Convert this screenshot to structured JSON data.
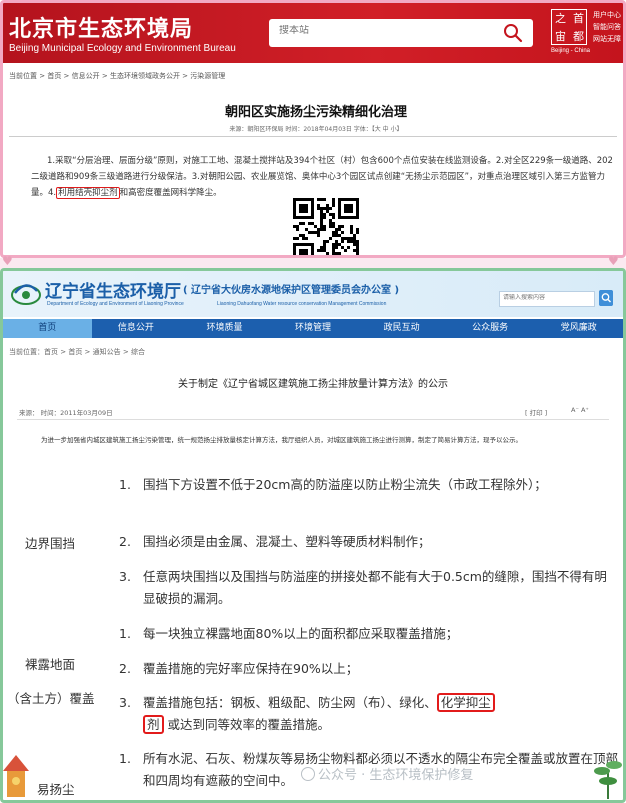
{
  "beijing": {
    "header": {
      "title": "北京市生态环境局",
      "subtitle": "Beijing Municipal Ecology and Environment Bureau",
      "search_placeholder": "搜本站",
      "logo_chars": [
        "之",
        "首",
        "宙",
        "都"
      ],
      "logo_caption": "Beijing - China",
      "links": [
        "用户中心",
        "智能问答",
        "网站无障"
      ]
    },
    "breadcrumb": "当前位置 > 首页 > 信息公开 > 生态环境领域政务公开 > 污染源管理",
    "article": {
      "title": "朝阳区实施扬尘污染精细化治理",
      "meta": "来源：朝阳区环保局    时间：2018年04月03日    字体：【大 中 小】",
      "body_part1": "1.采取“分层治理、层面分级”原则，对施工工地、混凝土搅拌站及394个社区（村）包含600个点位安装在线监测设备。2.对全区229条一级道路、202二级道路和909条三级道路进行分级保洁。3.对朝阳公园、农业展览馆、奥体中心3个园区试点创建“无扬尘示范园区”，对重点治理区域引入第三方监管力量。4.",
      "body_highlight": "利用结壳抑尘剂",
      "body_part2": "和高密度覆盖网科学降尘。"
    }
  },
  "liaoning": {
    "header": {
      "title": "辽宁省生态环境厅",
      "title_sub": "( 辽宁省大伙房水源地保护区管理委员会办公室 )",
      "en_left": "Department of Ecology and Environment of Liaoning Province",
      "en_right": "Liaoning Dahuofang Water resource conservation Management Commission",
      "search_placeholder": "请输入搜索内容"
    },
    "nav": [
      "首页",
      "信息公开",
      "环境质量",
      "环境管理",
      "政民互动",
      "公众服务",
      "党风廉政"
    ],
    "breadcrumb": "当前位置：首页 > 首页 > 通知公告 > 综合",
    "article": {
      "title": "关于制定《辽宁省城区建筑施工扬尘排放量计算方法》的公示",
      "source": "来源：    时间：2011年03月09日",
      "print": "[ 打印 ]",
      "font_controls": "A⁻  A⁺",
      "intro": "为进一步加强省内城区建筑施工扬尘污染管理，统一规范扬尘排放量核定计算方法，我厅组织人员，对城区建筑施工扬尘进行测算，制定了简易计算方法，现予以公示。"
    },
    "categories": [
      "边界围挡",
      "裸露地面",
      "（含土方）覆盖",
      "易扬尘"
    ],
    "items": [
      {
        "num": "1.",
        "text": "围挡下方设置不低于20cm高的防溢座以防止粉尘流失（市政工程除外）；"
      },
      {
        "num": "2.",
        "text": "围挡必须是由金属、混凝土、塑料等硬质材料制作；"
      },
      {
        "num": "3.",
        "text": "任意两块围挡以及围挡与防溢座的拼接处都不能有大于0.5cm的缝隙，围挡不得有明显破损的漏洞。"
      },
      {
        "num": "1.",
        "text": "每一块独立裸露地面80%以上的面积都应采取覆盖措施；"
      },
      {
        "num": "2.",
        "text": "覆盖措施的完好率应保持在90%以上；"
      },
      {
        "num": "3.",
        "text_before": "覆盖措施包括：钢板、粗级配、防尘网（布）、绿化、",
        "highlight_a": "化学抑尘",
        "highlight_b": "剂",
        "text_after": "或达到同等效率的覆盖措施。"
      },
      {
        "num": "1.",
        "text": "所有水泥、石灰、粉煤灰等易扬尘物料都必须以不透水的隔尘布完全覆盖或放置在顶部和四周均有遮蔽的空间中。"
      }
    ],
    "watermark": "公众号 · 生态环境保护修复"
  },
  "colors": {
    "beijing_red": "#c4141d",
    "liaoning_blue": "#1c5fae",
    "highlight_red": "#e21b1b",
    "top_frame_pink": "#f2a9c3",
    "bottom_frame_green": "#86c89a"
  }
}
